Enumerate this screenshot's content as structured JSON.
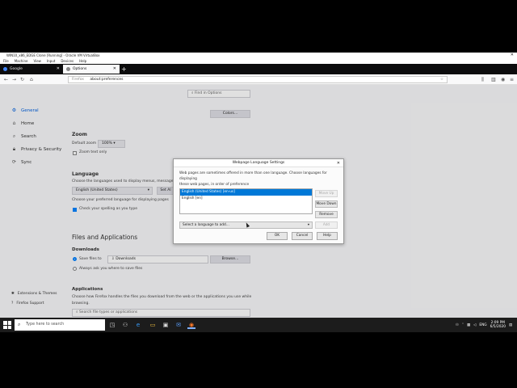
{
  "vbox": {
    "title": "WIN10_x86_EDGE Clone [Running] - Oracle VM VirtualBox",
    "menu": [
      "File",
      "Machine",
      "View",
      "Input",
      "Devices",
      "Help"
    ]
  },
  "browser": {
    "tabs": [
      {
        "label": "Google"
      },
      {
        "label": "Options"
      }
    ],
    "url_prefix": "Firefox",
    "url": "about:preferences"
  },
  "sidebar": {
    "items": [
      {
        "label": "General",
        "icon": "gear-icon"
      },
      {
        "label": "Home",
        "icon": "home-icon"
      },
      {
        "label": "Search",
        "icon": "search-icon"
      },
      {
        "label": "Privacy & Security",
        "icon": "lock-icon"
      },
      {
        "label": "Sync",
        "icon": "sync-icon"
      }
    ],
    "bottom": [
      {
        "label": "Extensions & Themes",
        "icon": "puzzle-icon"
      },
      {
        "label": "Firefox Support",
        "icon": "help-icon"
      }
    ]
  },
  "main": {
    "find_placeholder": "Find in Options",
    "colors_button": "Colors...",
    "zoom": {
      "heading": "Zoom",
      "default_label": "Default zoom",
      "default_value": "100%",
      "text_only": "Zoom text only"
    },
    "language": {
      "heading": "Language",
      "desc": "Choose the languages used to display menus, messages",
      "select_value": "English (United States)",
      "set_alt_button": "Set Al",
      "pref_desc": "Choose your preferred language for displaying pages",
      "spelling": "Check your spelling as you type"
    },
    "files": {
      "heading": "Files and Applications",
      "downloads_heading": "Downloads",
      "save_files_label": "Save files to",
      "downloads_folder": "Downloads",
      "browse_button": "Browse...",
      "always_ask": "Always ask you where to save files"
    },
    "applications": {
      "heading": "Applications",
      "desc_line1": "Choose how Firefox handles the files you download from the web or the applications you use while",
      "desc_line2": "browsing.",
      "search_placeholder": "Search file types or applications"
    }
  },
  "dialog": {
    "title": "Webpage Language Settings",
    "desc_line1": "Web pages are sometimes offered in more than one language. Choose languages for displaying",
    "desc_line2": "these web pages, in order of preference",
    "languages": [
      {
        "label": "English (United States) [en-us]",
        "selected": true
      },
      {
        "label": "English [en]",
        "selected": false
      }
    ],
    "buttons": {
      "move_up": "Move Up",
      "move_down": "Move Down",
      "remove": "Remove",
      "add": "Add"
    },
    "select_placeholder": "Select a language to add...",
    "ok": "OK",
    "cancel": "Cancel",
    "help": "Help"
  },
  "taskbar": {
    "search_placeholder": "Type here to search",
    "tray_lang": "ENG",
    "time": "2:09 PM",
    "date": "6/5/2020"
  }
}
